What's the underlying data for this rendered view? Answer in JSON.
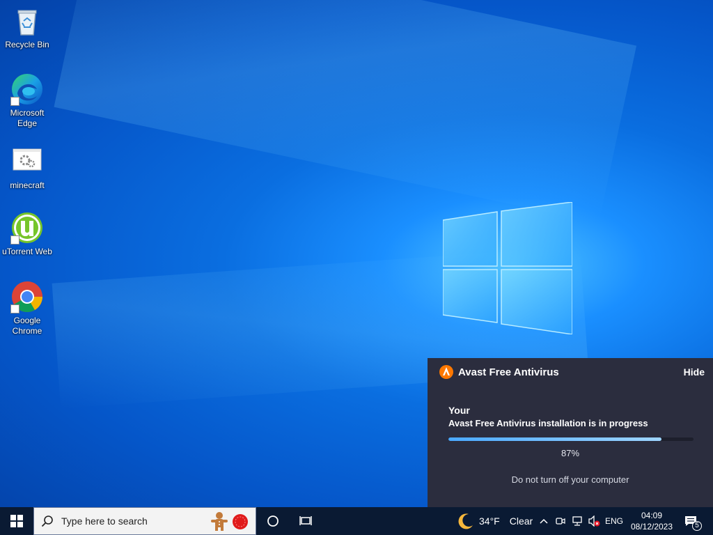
{
  "desktop": {
    "icons": [
      {
        "label": "Recycle Bin",
        "icon": "recycle-bin-icon"
      },
      {
        "label": "Microsoft Edge",
        "icon": "edge-icon"
      },
      {
        "label": "minecraft",
        "icon": "settings-file-icon"
      },
      {
        "label": "uTorrent Web",
        "icon": "utorrent-icon"
      },
      {
        "label": "Google Chrome",
        "icon": "chrome-icon"
      }
    ]
  },
  "avast": {
    "title": "Avast Free Antivirus",
    "hide_label": "Hide",
    "line1": "Your",
    "line2": "Avast Free Antivirus installation is in progress",
    "progress_text": "87%",
    "progress_value": 0.87,
    "note": "Do not turn off your computer",
    "accent": "#ff7800"
  },
  "taskbar": {
    "search_placeholder": "Type here to search",
    "weather_temp": "34°F",
    "weather_condition": "Clear",
    "language": "ENG",
    "time": "04:09",
    "date": "08/12/2023",
    "notification_count": "5"
  }
}
